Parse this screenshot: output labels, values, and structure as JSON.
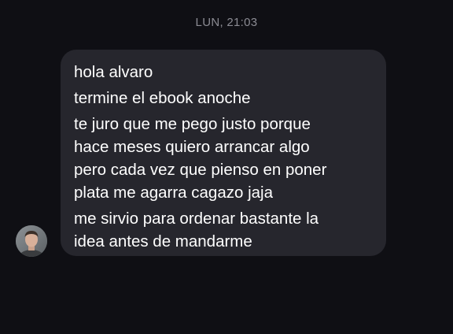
{
  "timestamp": "LUN, 21:03",
  "message": {
    "lines": [
      "hola alvaro",
      "termine el ebook anoche",
      "te juro que me pego justo porque",
      "hace meses quiero arrancar algo",
      "pero cada vez que pienso en poner",
      "plata me agarra cagazo jaja",
      "me sirvio para ordenar bastante la",
      "idea antes de mandarme"
    ]
  },
  "avatar": {
    "icon": "contact-photo"
  },
  "colors": {
    "background": "#0f0f14",
    "bubble": "#26262d",
    "text": "#ffffff",
    "timestamp": "#8b8b93"
  }
}
